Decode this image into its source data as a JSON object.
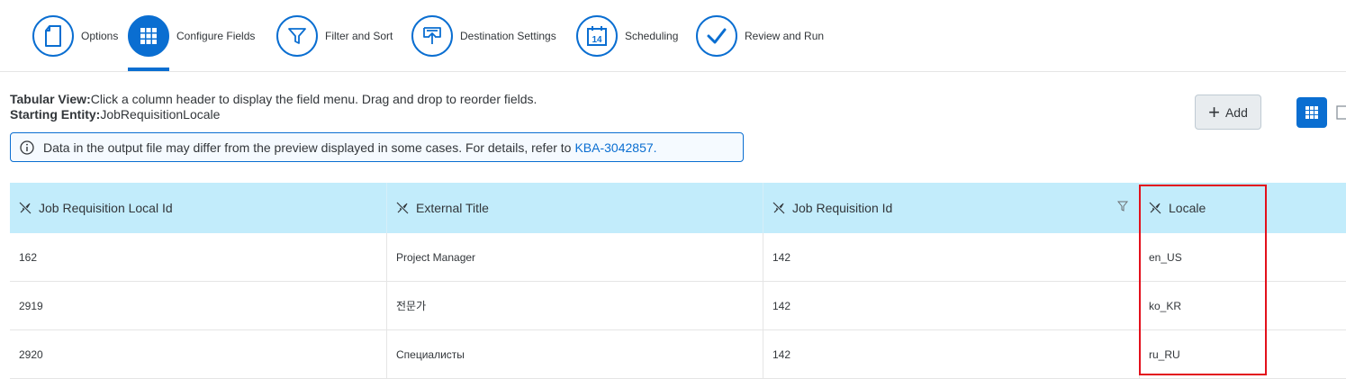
{
  "wizard": {
    "steps": [
      {
        "label": "Options",
        "icon": "options-icon",
        "active": false
      },
      {
        "label": "Configure Fields",
        "icon": "grid-icon",
        "active": true
      },
      {
        "label": "Filter and Sort",
        "icon": "filter-icon",
        "active": false
      },
      {
        "label": "Destination Settings",
        "icon": "destination-icon",
        "active": false
      },
      {
        "label": "Scheduling",
        "icon": "calendar-icon",
        "active": false
      },
      {
        "label": "Review and Run",
        "icon": "checkmark-icon",
        "active": false
      }
    ],
    "calendar_day": "14"
  },
  "info": {
    "tabular_label": "Tabular View:",
    "tabular_text": "Click a column header to display the field menu. Drag and drop to reorder fields.",
    "entity_label": "Starting Entity:",
    "entity_value": "JobRequisitionLocale",
    "notice_text": "Data in the output file may differ from the preview displayed in some cases. For details, refer to",
    "notice_link": "KBA-3042857."
  },
  "toolbar": {
    "add_label": "Add"
  },
  "table": {
    "columns": [
      "Job Requisition Local Id",
      "External Title",
      "Job Requisition Id",
      "Locale"
    ],
    "rows": [
      [
        "162",
        "Project Manager",
        "142",
        "en_US"
      ],
      [
        "2919",
        "전문가",
        "142",
        "ko_KR"
      ],
      [
        "2920",
        "Специалисты",
        "142",
        "ru_RU"
      ]
    ]
  },
  "colors": {
    "accent": "#0a6ed1",
    "header_bg": "#c2ecfb",
    "highlight": "#e3101b"
  }
}
